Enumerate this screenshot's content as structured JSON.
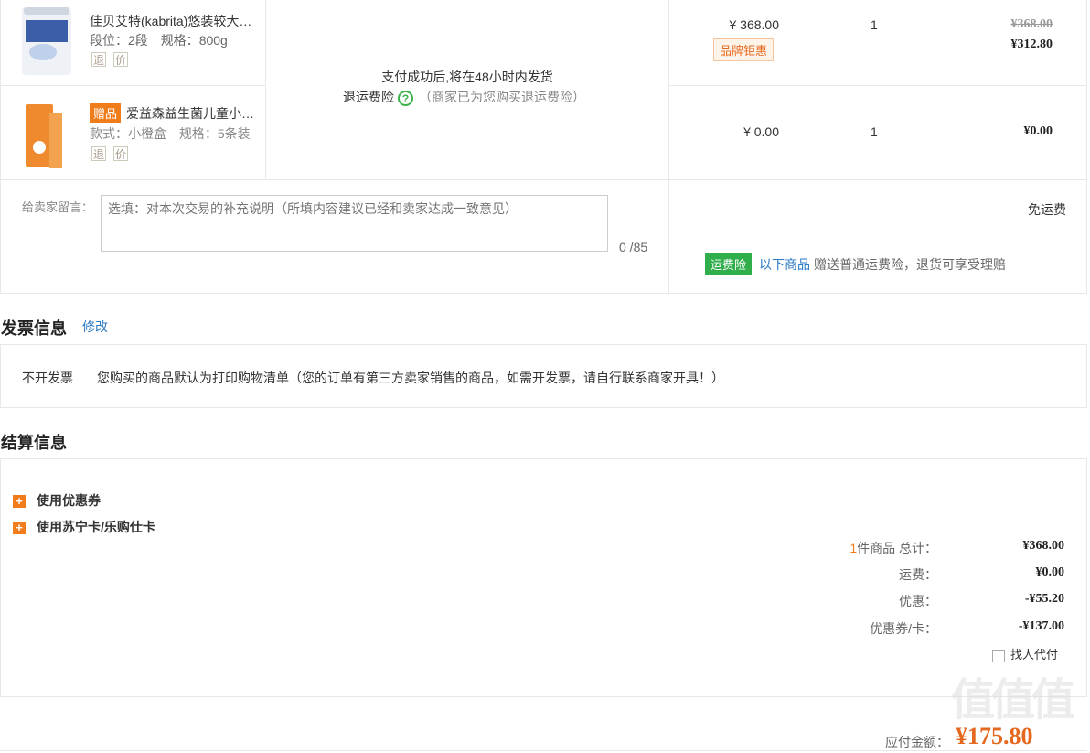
{
  "items": [
    {
      "name": "佳贝艾特(kabrita)悠装较大…",
      "spec1_label": "段位：",
      "spec1_value": "2段",
      "spec2_label": "规格：",
      "spec2_value": "800g",
      "icon_return": "退",
      "icon_price": "价",
      "unit_price": "¥ 368.00",
      "brand_tag": "品牌钜惠",
      "qty": "1",
      "orig_total": "¥368.00",
      "total": "¥312.80"
    },
    {
      "gift_tag": "赠品",
      "name": "爱益森益生菌儿童小…",
      "spec1_label": "款式：",
      "spec1_value": "小橙盒",
      "spec2_label": "规格：",
      "spec2_value": "5条装",
      "icon_return": "退",
      "icon_price": "价",
      "unit_price": "¥ 0.00",
      "qty": "1",
      "total": "¥0.00"
    }
  ],
  "shipping_note": "支付成功后,将在48小时内发货",
  "return_insurance": {
    "label": "退运费险",
    "icon": "question-icon",
    "note": "（商家已为您购买退运费险）"
  },
  "message": {
    "label": "给卖家留言：",
    "placeholder": "选填：对本次交易的补充说明（所填内容建议已经和卖家达成一致意见）",
    "counter": "0 /85"
  },
  "freight": {
    "free_label": "免运费",
    "badge": "运费险",
    "link": "以下商品",
    "desc": "赠送普通运费险，退货可享受理赔"
  },
  "invoice": {
    "title": "发票信息",
    "edit": "修改",
    "type": "不开发票",
    "desc": "您购买的商品默认为打印购物清单（您的订单有第三方卖家销售的商品，如需开发票，请自行联系商家开具！）"
  },
  "settlement": {
    "title": "结算信息",
    "coupon": "使用优惠券",
    "card": "使用苏宁卡/乐购仕卡",
    "count": "1",
    "count_suffix": "件商品 总计：",
    "total": "¥368.00",
    "freight_label": "运费：",
    "freight_value": "¥0.00",
    "discount_label": "优惠：",
    "discount_value": "-¥55.20",
    "coupon_label": "优惠券/卡：",
    "coupon_value": "-¥137.00",
    "proxy_pay": "找人代付"
  },
  "payable": {
    "label": "应付金额：",
    "value": "¥175.80"
  },
  "watermark": "值",
  "colors": {
    "accent": "#f07c1c",
    "green": "#2fae4b",
    "link": "#2a79c5",
    "price": "#e4681e"
  }
}
